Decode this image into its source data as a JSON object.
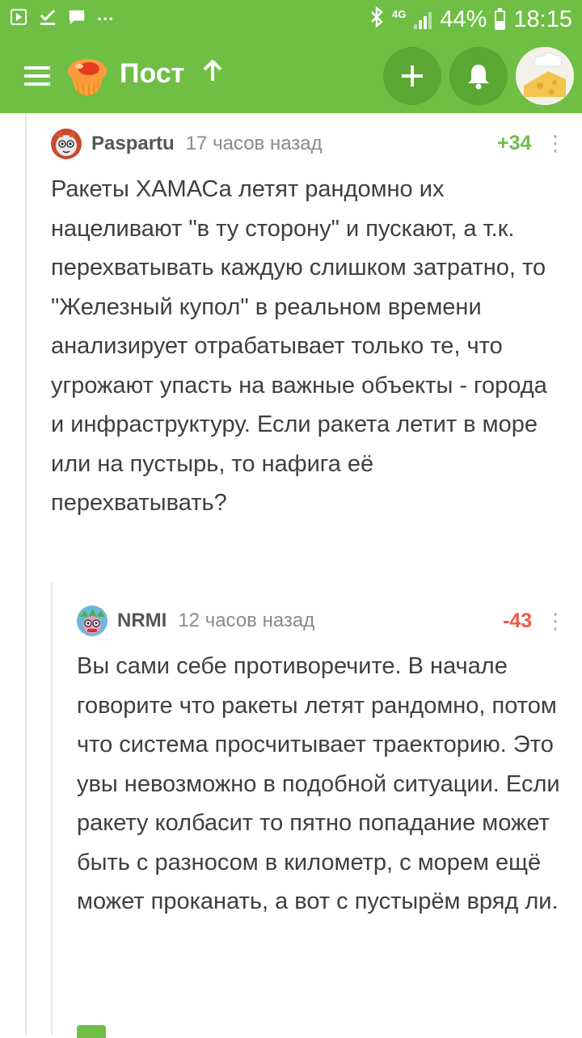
{
  "status_bar": {
    "network": "4G",
    "battery": "44%",
    "battery_level": 0.44,
    "time": "18:15",
    "more": "...",
    "icons": [
      "play-notification-icon",
      "check-download-icon",
      "message-icon",
      "bluetooth-icon",
      "signal-icon",
      "battery-icon"
    ]
  },
  "app_bar": {
    "title": "Пост",
    "icons": [
      "menu-icon",
      "pikabu-logo",
      "arrow-up-icon",
      "plus-icon",
      "bell-icon",
      "user-avatar"
    ]
  },
  "comments": [
    {
      "author": "Paspartu",
      "time": "17 часов назад",
      "rating": "+34",
      "rating_color": "#6fbf45",
      "text": "Ракеты ХАМАСа летят рандомно их нацеливают \"в ту сторону\" и пускают, а т.к. перехватывать каждую слишком затратно, то \"Железный купол\" в реальном времени анализирует отрабатывает только те, что угрожают упасть на важные объекты - города и инфраструктуру. Если ракета летит в море или на пустырь, то нафига её перехватывать?"
    },
    {
      "author": "NRMI",
      "time": "12 часов назад",
      "rating": "-43",
      "rating_color": "#ef5a42",
      "text": "Вы сами себе противоречите. В начале говорите что ракеты летят рандомно, потом что система просчитывает траекторию. Это увы невозможно в подобной ситуации. Если ракету колбасит то пятно попадание может быть с разносом в километр, с морем ещё может проканать, а вот с пустырём вряд ли."
    }
  ],
  "colors": {
    "brand": "#6fbf45",
    "brand_dark": "#5aa833"
  }
}
